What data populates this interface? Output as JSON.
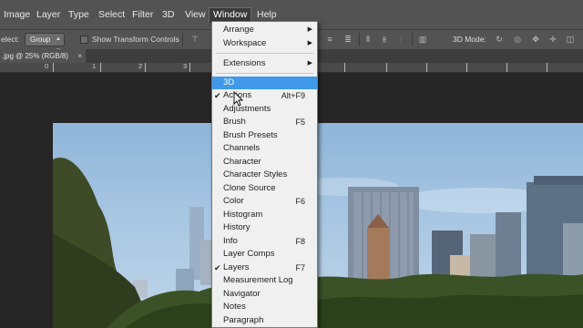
{
  "menubar": {
    "items": [
      "Image",
      "Layer",
      "Type",
      "Select",
      "Filter",
      "3D",
      "View",
      "Window",
      "Help"
    ],
    "active": "Window"
  },
  "options_bar": {
    "select_label": "elect:",
    "select_value": "Group",
    "transform_controls_label": "Show Transform Controls",
    "mode_3d_label": "3D Mode:"
  },
  "document_tab": {
    "title": ".jpg @ 25% (RGB/8)",
    "close": "×"
  },
  "ruler": {
    "labels": [
      "0",
      "1",
      "2",
      "3"
    ]
  },
  "window_menu": {
    "groups": [
      [
        {
          "label": "Arrange",
          "submenu": true
        },
        {
          "label": "Workspace",
          "submenu": true
        }
      ],
      [
        {
          "label": "Extensions",
          "submenu": true
        }
      ],
      [
        {
          "label": "3D",
          "highlighted": true
        },
        {
          "label": "Actions",
          "shortcut": "Alt+F9",
          "checked": true
        },
        {
          "label": "Adjustments"
        },
        {
          "label": "Brush",
          "shortcut": "F5"
        },
        {
          "label": "Brush Presets"
        },
        {
          "label": "Channels"
        },
        {
          "label": "Character"
        },
        {
          "label": "Character Styles"
        },
        {
          "label": "Clone Source"
        },
        {
          "label": "Color",
          "shortcut": "F6"
        },
        {
          "label": "Histogram"
        },
        {
          "label": "History"
        },
        {
          "label": "Info",
          "shortcut": "F8"
        },
        {
          "label": "Layer Comps"
        },
        {
          "label": "Layers",
          "shortcut": "F7",
          "checked": true
        },
        {
          "label": "Measurement Log"
        },
        {
          "label": "Navigator"
        },
        {
          "label": "Notes"
        },
        {
          "label": "Paragraph"
        }
      ]
    ]
  },
  "colors": {
    "highlight": "#3f98e8",
    "menu_bg": "#f0f0f0",
    "chrome": "#535353"
  }
}
